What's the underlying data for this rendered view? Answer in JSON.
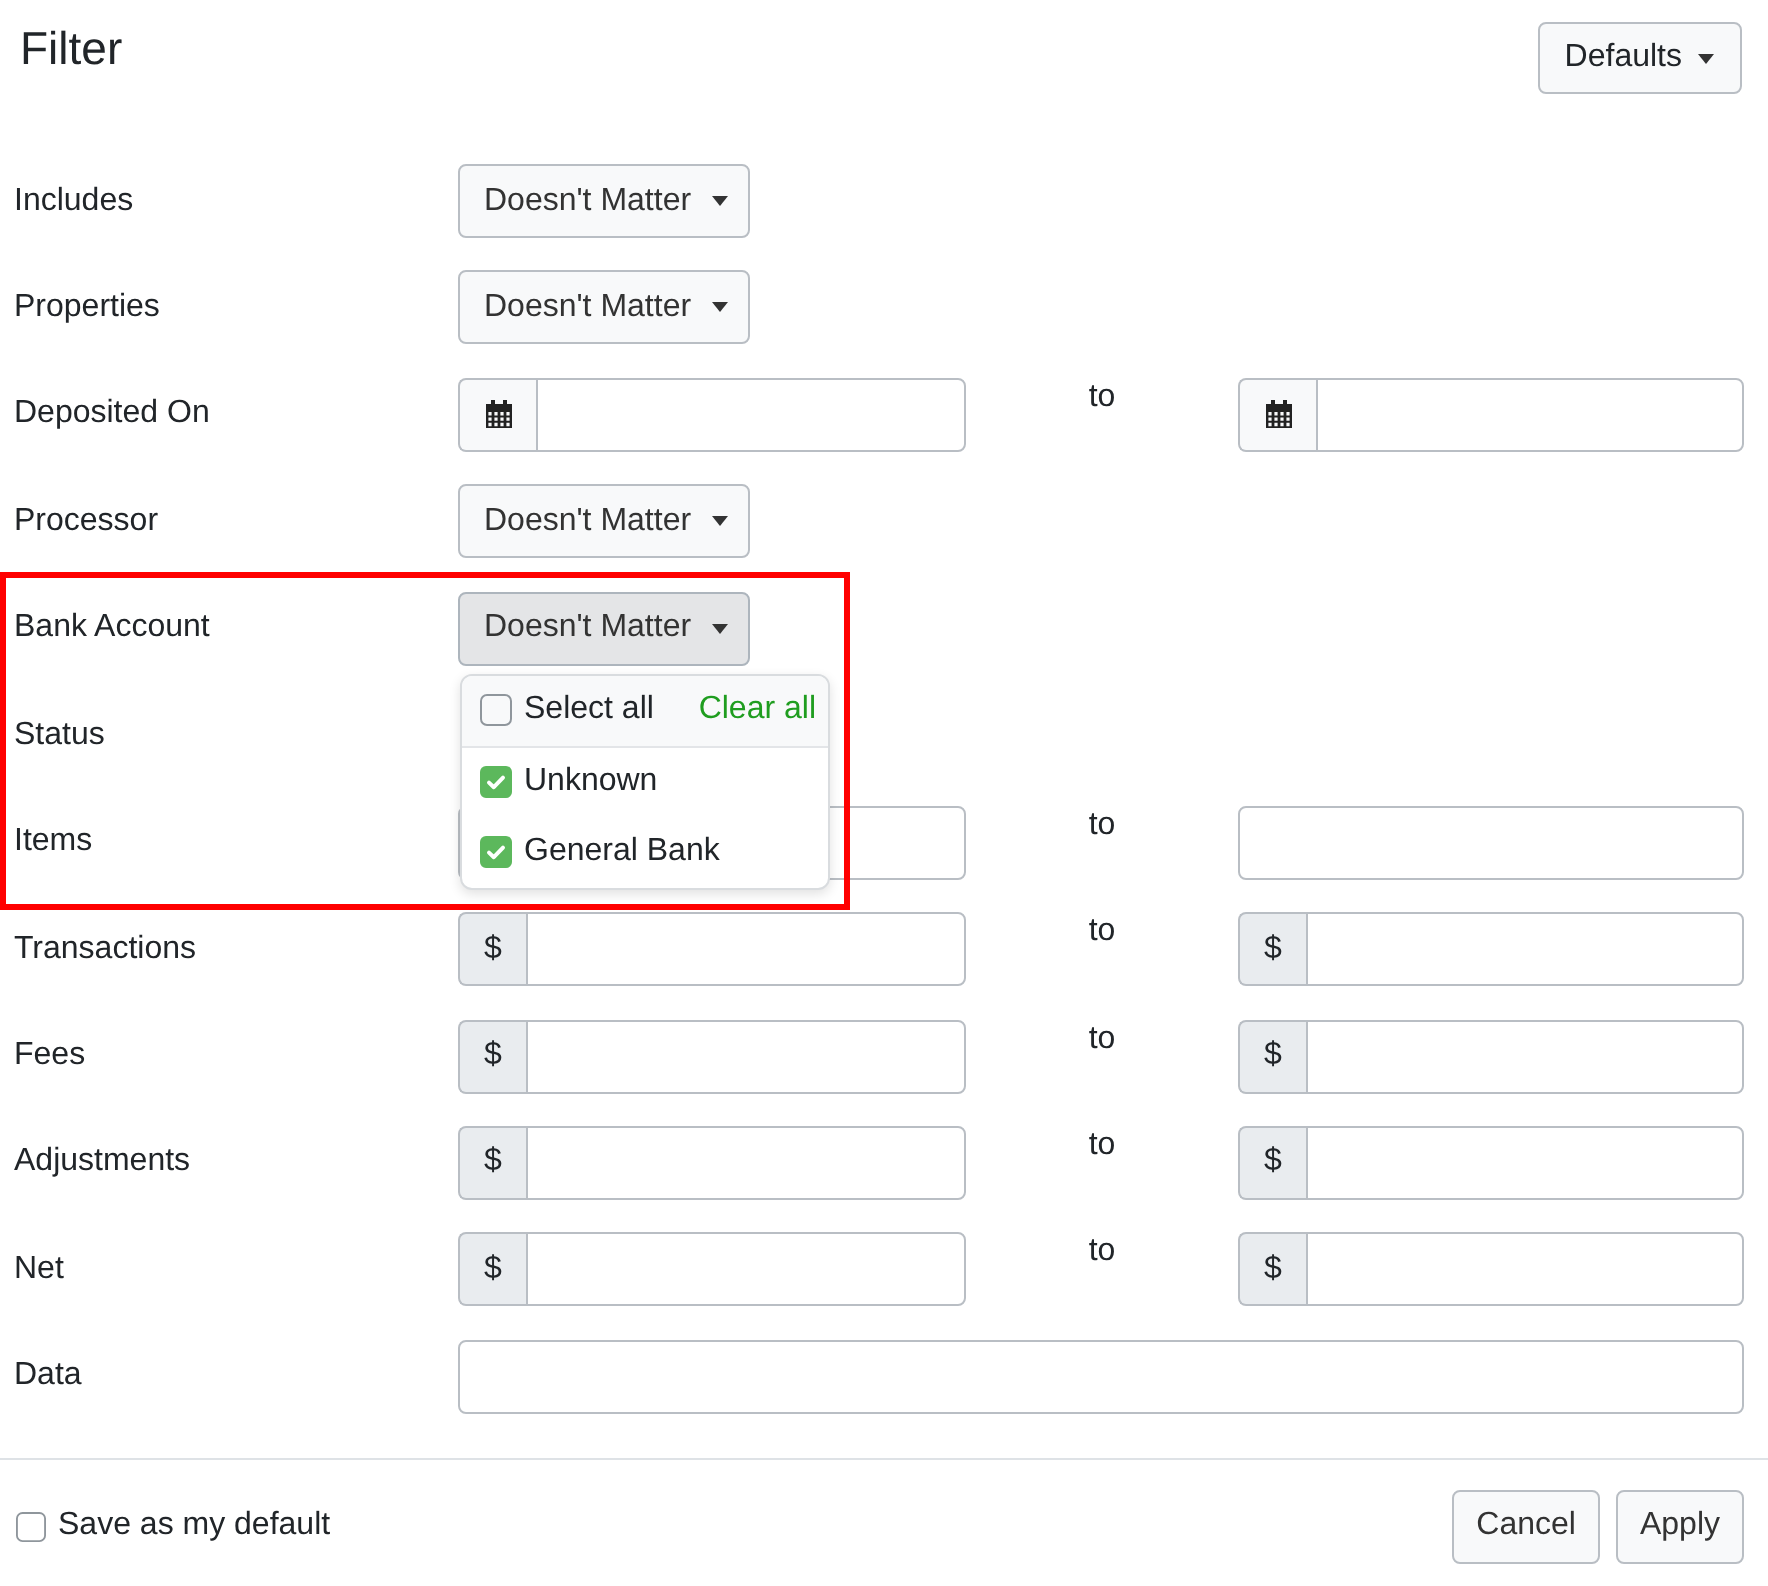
{
  "title": "Filter",
  "defaults_button": {
    "label": "Defaults"
  },
  "rows": [
    {
      "label": "Includes",
      "kind": "select",
      "value": "Doesn't Matter",
      "expanded": false,
      "highlighted": false
    },
    {
      "label": "Properties",
      "kind": "select",
      "value": "Doesn't Matter",
      "expanded": false,
      "highlighted": false
    },
    {
      "label": "Deposited On",
      "kind": "date-range",
      "separator": "to",
      "highlighted": false
    },
    {
      "label": "Processor",
      "kind": "select",
      "value": "Doesn't Matter",
      "expanded": false,
      "highlighted": false
    },
    {
      "label": "Bank Account",
      "kind": "select",
      "value": "Doesn't Matter",
      "expanded": true,
      "highlighted": true,
      "menu": {
        "select_all": {
          "label": "Select all",
          "checked": false
        },
        "clear_all": "Clear all",
        "options": [
          {
            "label": "Unknown",
            "checked": true
          },
          {
            "label": "General Bank",
            "checked": true
          }
        ]
      }
    },
    {
      "label": "Status",
      "kind": "covered",
      "highlighted": false
    },
    {
      "label": "Items",
      "kind": "range",
      "separator": "to",
      "highlighted": false
    },
    {
      "label": "Transactions",
      "kind": "money-range",
      "from_prefix": "$",
      "separator": "to",
      "to_prefix": "$",
      "highlighted": false
    },
    {
      "label": "Fees",
      "kind": "money-range",
      "from_prefix": "$",
      "separator": "to",
      "to_prefix": "$",
      "highlighted": false
    },
    {
      "label": "Adjustments",
      "kind": "money-range",
      "from_prefix": "$",
      "separator": "to",
      "to_prefix": "$",
      "highlighted": false
    },
    {
      "label": "Net",
      "kind": "money-range",
      "from_prefix": "$",
      "separator": "to",
      "to_prefix": "$",
      "highlighted": false
    },
    {
      "label": "Data",
      "kind": "text",
      "highlighted": false
    }
  ],
  "footer": {
    "save_default": {
      "label": "Save as my default",
      "checked": false
    },
    "buttons": [
      "Cancel",
      "Apply"
    ]
  }
}
